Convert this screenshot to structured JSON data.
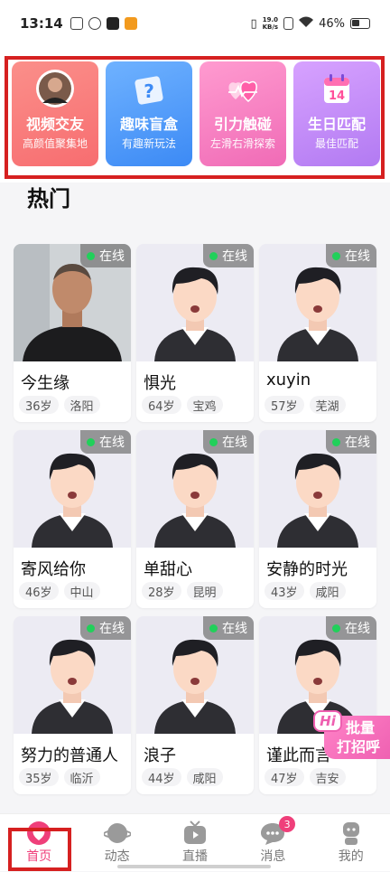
{
  "status_bar": {
    "time": "13:14",
    "net_speed_value": "19.0",
    "net_speed_unit": "KB/s",
    "battery": "46%"
  },
  "features": [
    {
      "title": "视频交友",
      "subtitle": "高颜值聚集地",
      "icon": "avatar-portrait-icon",
      "color": "#f76d70"
    },
    {
      "title": "趣味盲盒",
      "subtitle": "有趣新玩法",
      "icon": "mystery-box-icon",
      "color": "#3c8af5"
    },
    {
      "title": "引力触碰",
      "subtitle": "左滑右滑探索",
      "icon": "hearts-icon",
      "color": "#f06bb6"
    },
    {
      "title": "生日匹配",
      "subtitle": "最佳匹配",
      "icon": "calendar-icon",
      "calendar_day": "14",
      "color": "#b27af2"
    }
  ],
  "section": {
    "title": "热门"
  },
  "online_label": "在线",
  "users": [
    {
      "name": "今生缘",
      "age": "36岁",
      "city": "洛阳",
      "photo": "real-photo"
    },
    {
      "name": "惧光",
      "age": "64岁",
      "city": "宝鸡",
      "photo": "default-avatar"
    },
    {
      "name": "xuyin",
      "age": "57岁",
      "city": "芜湖",
      "photo": "default-avatar"
    },
    {
      "name": "寄风给你",
      "age": "46岁",
      "city": "中山",
      "photo": "default-avatar"
    },
    {
      "name": "单甜心",
      "age": "28岁",
      "city": "昆明",
      "photo": "default-avatar"
    },
    {
      "name": "安静的时光",
      "age": "43岁",
      "city": "咸阳",
      "photo": "default-avatar"
    },
    {
      "name": "努力的普通人",
      "age": "35岁",
      "city": "临沂",
      "photo": "default-avatar"
    },
    {
      "name": "浪子",
      "age": "44岁",
      "city": "咸阳",
      "photo": "default-avatar"
    },
    {
      "name": "谨此而言",
      "age": "47岁",
      "city": "吉安",
      "photo": "default-avatar"
    }
  ],
  "batch_greet": {
    "hi": "Hi",
    "line1": "批量",
    "line2": "打招呼"
  },
  "tabbar": [
    {
      "label": "首页",
      "icon": "home-heart-icon",
      "active": true
    },
    {
      "label": "动态",
      "icon": "planet-icon"
    },
    {
      "label": "直播",
      "icon": "tv-icon"
    },
    {
      "label": "消息",
      "icon": "chat-bubble-icon",
      "badge": "3"
    },
    {
      "label": "我的",
      "icon": "person-icon"
    }
  ],
  "colors": {
    "accent": "#ef3f7a",
    "online": "#21d05a",
    "highlight_frame": "#d62020"
  }
}
